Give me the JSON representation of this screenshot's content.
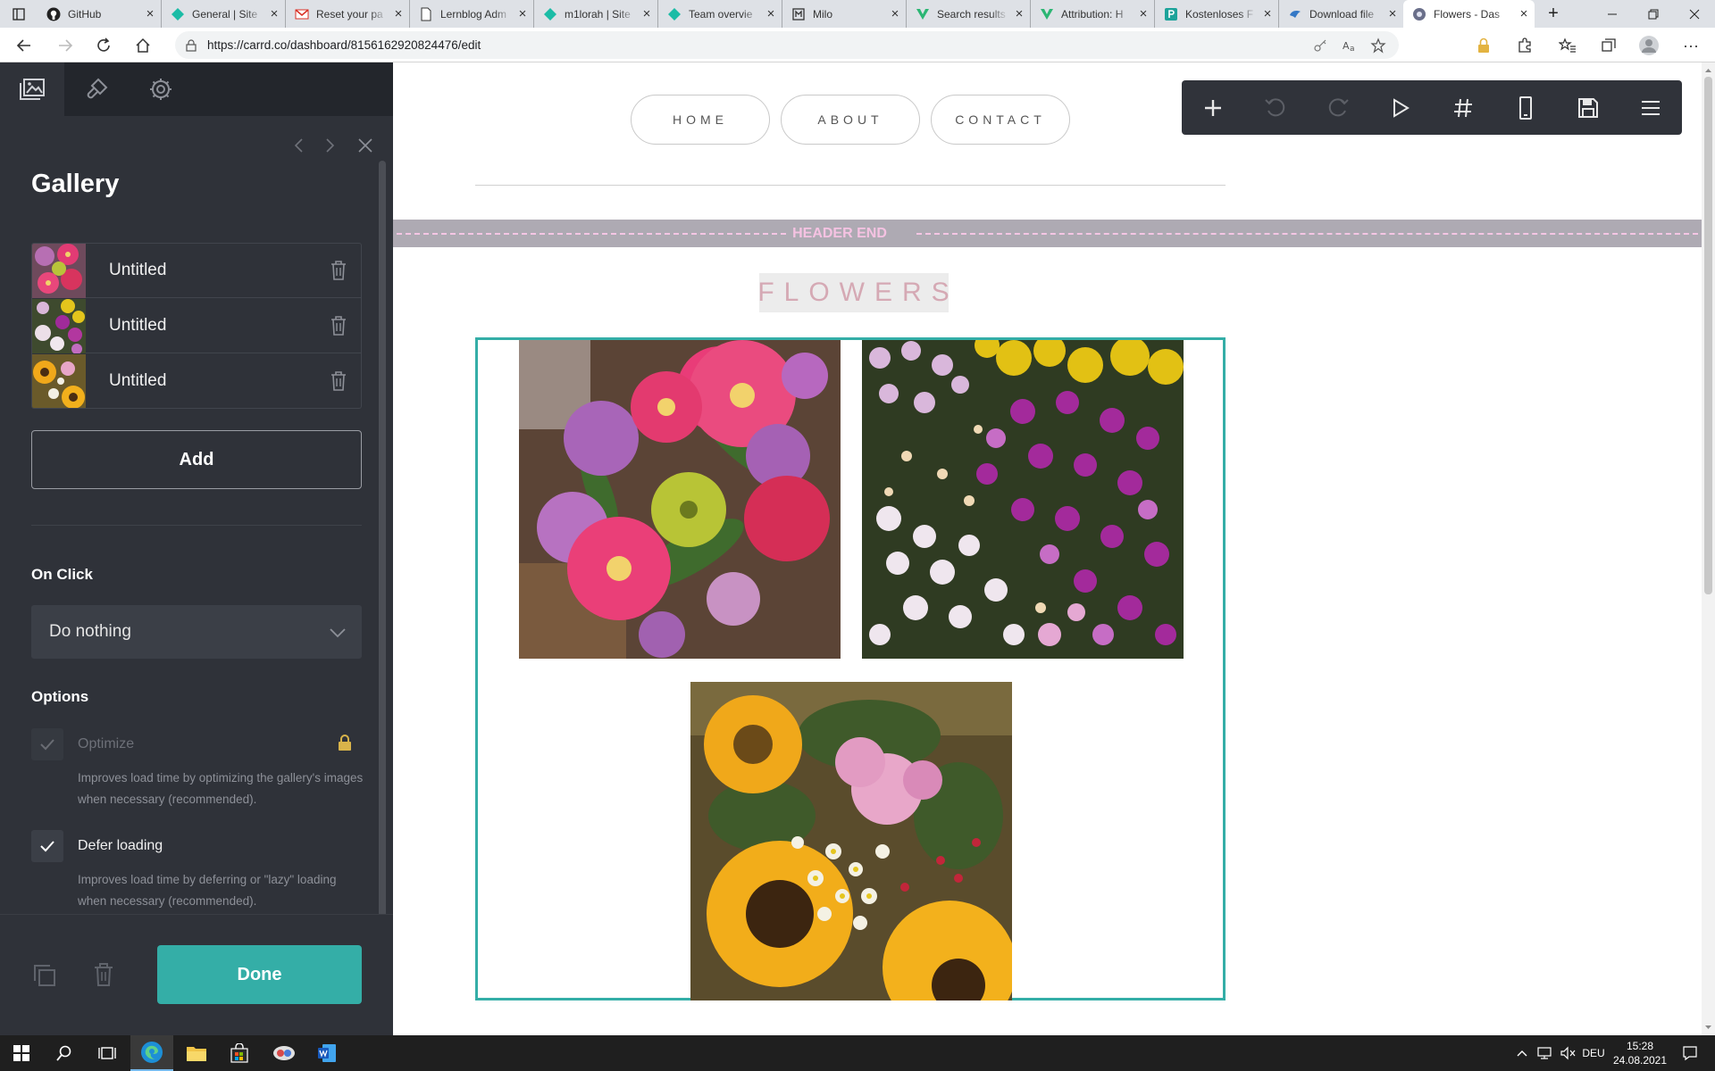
{
  "browser": {
    "tabs": [
      {
        "title": "GitHub",
        "icon": "github-icon"
      },
      {
        "title": "General | Site",
        "icon": "diamond-icon"
      },
      {
        "title": "Reset your pa",
        "icon": "gmail-icon"
      },
      {
        "title": "Lernblog Adm",
        "icon": "document-icon"
      },
      {
        "title": "m1lorah | Site",
        "icon": "diamond-icon"
      },
      {
        "title": "Team overvie",
        "icon": "diamond-icon"
      },
      {
        "title": "Milo",
        "icon": "sheet-icon"
      },
      {
        "title": "Search results",
        "icon": "v-logo-icon"
      },
      {
        "title": "Attribution: H",
        "icon": "v-logo-icon"
      },
      {
        "title": "Kostenloses F",
        "icon": "letter-p-icon"
      },
      {
        "title": "Download file",
        "icon": "bird-icon"
      },
      {
        "title": "Flowers - Das",
        "icon": "carrd-icon"
      }
    ],
    "new_tab": "+",
    "url": "https://carrd.co/dashboard/8156162920824476/edit"
  },
  "panel": {
    "tab_icons": [
      "media-icon",
      "brush-icon",
      "settings-icon"
    ],
    "title": "Gallery",
    "items": [
      {
        "name": "Untitled",
        "thumb": "pink-bouquet"
      },
      {
        "name": "Untitled",
        "thumb": "purple-asters"
      },
      {
        "name": "Untitled",
        "thumb": "sunflowers"
      }
    ],
    "add_label": "Add",
    "on_click": {
      "heading": "On Click",
      "value": "Do nothing"
    },
    "options": {
      "heading": "Options",
      "optimize": {
        "label": "Optimize",
        "checked": true,
        "locked": true,
        "description": "Improves load time by optimizing the gallery's images when necessary (recommended)."
      },
      "defer": {
        "label": "Defer loading",
        "checked": true,
        "description": "Improves load time by deferring or \"lazy\" loading when necessary (recommended)."
      }
    },
    "done_label": "Done"
  },
  "site": {
    "nav": [
      "HOME",
      "ABOUT",
      "CONTACT"
    ],
    "header_end_label": "HEADER END",
    "title": "FLOWERS",
    "photos": [
      "pink-bouquet",
      "purple-asters",
      "sunflowers"
    ]
  },
  "toolbar": {
    "icons": [
      "add-icon",
      "undo-icon",
      "redo-icon",
      "preview-icon",
      "hash-icon",
      "mobile-icon",
      "save-icon",
      "menu-icon"
    ],
    "disabled": [
      "undo-icon",
      "redo-icon"
    ]
  },
  "taskbar": {
    "language": "DEU",
    "time": "15:28",
    "date": "24.08.2021"
  },
  "colors": {
    "accent": "#34aea7",
    "panel_bg": "#2f3239",
    "header_end_bar": "#aeaab3",
    "header_end_text": "#f5c2e2",
    "title_text": "#d5a9b4"
  }
}
